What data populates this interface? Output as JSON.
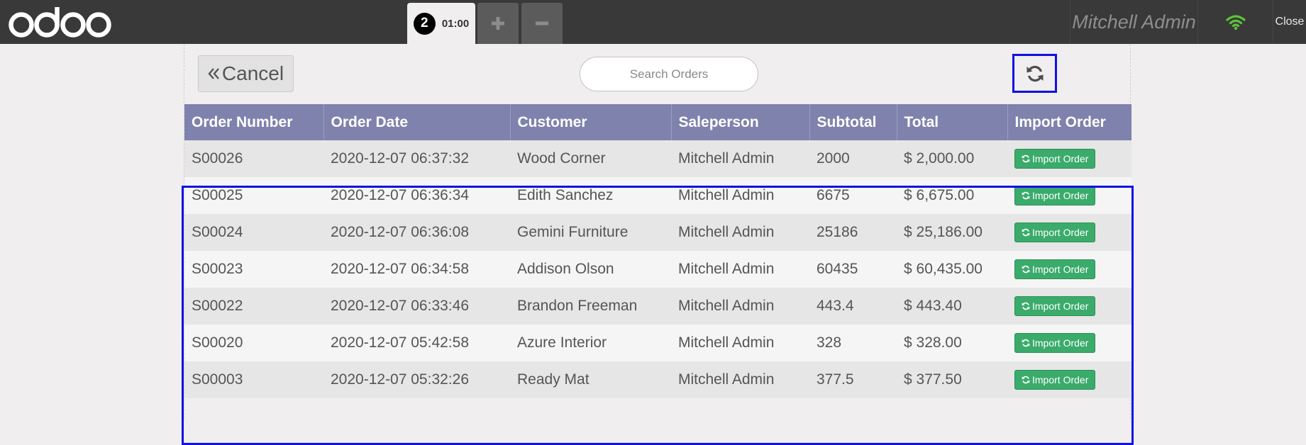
{
  "topbar": {
    "logo_text": "odoo",
    "order_tab": {
      "badge": "2",
      "time": "01:00"
    },
    "add_order_icon": "plus-icon",
    "remove_order_icon": "minus-icon",
    "user_name": "Mitchell Admin",
    "wifi_icon": "wifi-icon",
    "wifi_color": "#5fc33a",
    "close_label": "Close"
  },
  "toolbar": {
    "cancel_label": "Cancel",
    "cancel_icon": "double-chevron-left-icon",
    "search_placeholder": "Search Orders",
    "refresh_icon": "refresh-icon"
  },
  "table": {
    "columns": [
      "Order Number",
      "Order Date",
      "Customer",
      "Saleperson",
      "Subtotal",
      "Total",
      "Import Order"
    ],
    "header_color": "#7f82ac",
    "import_button_color": "#3aab6b",
    "rows": [
      {
        "number": "S00026",
        "date": "2020-12-07 06:37:32",
        "customer": "Wood Corner",
        "salesperson": "Mitchell Admin",
        "subtotal": "2000",
        "total": "$ 2,000.00",
        "action": "Import Order"
      },
      {
        "number": "S00025",
        "date": "2020-12-07 06:36:34",
        "customer": "Edith Sanchez",
        "salesperson": "Mitchell Admin",
        "subtotal": "6675",
        "total": "$ 6,675.00",
        "action": "Import Order"
      },
      {
        "number": "S00024",
        "date": "2020-12-07 06:36:08",
        "customer": "Gemini Furniture",
        "salesperson": "Mitchell Admin",
        "subtotal": "25186",
        "total": "$ 25,186.00",
        "action": "Import Order"
      },
      {
        "number": "S00023",
        "date": "2020-12-07 06:34:58",
        "customer": "Addison Olson",
        "salesperson": "Mitchell Admin",
        "subtotal": "60435",
        "total": "$ 60,435.00",
        "action": "Import Order"
      },
      {
        "number": "S00022",
        "date": "2020-12-07 06:33:46",
        "customer": "Brandon Freeman",
        "salesperson": "Mitchell Admin",
        "subtotal": "443.4",
        "total": "$ 443.40",
        "action": "Import Order"
      },
      {
        "number": "S00020",
        "date": "2020-12-07 05:42:58",
        "customer": "Azure Interior",
        "salesperson": "Mitchell Admin",
        "subtotal": "328",
        "total": "$ 328.00",
        "action": "Import Order"
      },
      {
        "number": "S00003",
        "date": "2020-12-07 05:32:26",
        "customer": "Ready Mat",
        "salesperson": "Mitchell Admin",
        "subtotal": "377.5",
        "total": "$ 377.50",
        "action": "Import Order"
      }
    ]
  }
}
